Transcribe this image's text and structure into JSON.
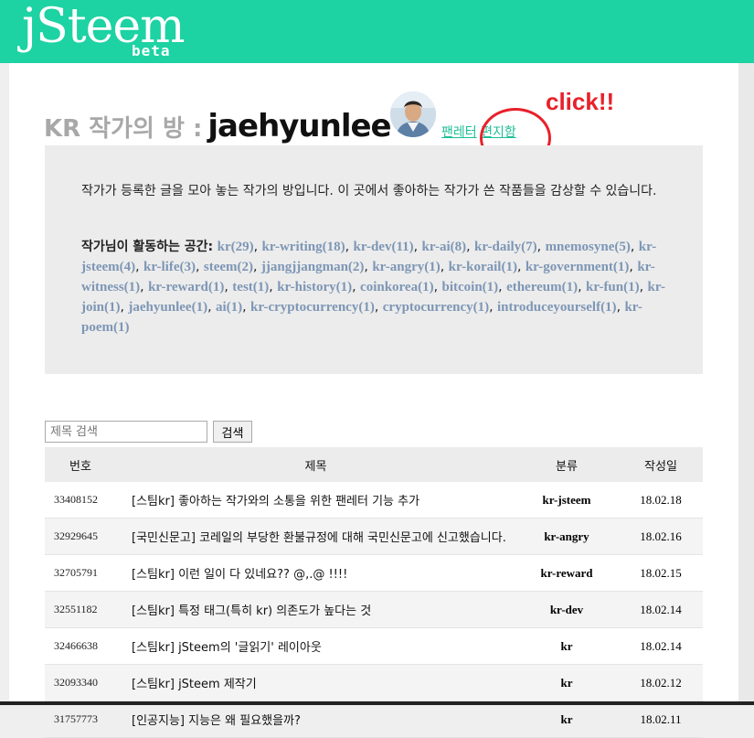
{
  "header": {
    "logo": "jSteem",
    "badge": "beta"
  },
  "page": {
    "title_prefix": "KR 작가의 방 :",
    "author": "jaehyunlee"
  },
  "links": {
    "fan_letter": "팬레터",
    "mailbox": "편지함"
  },
  "annotation": {
    "text": "click!!",
    "color": "#e8202a"
  },
  "intro": {
    "description": "작가가 등록한 글을 모아 놓는 작가의 방입니다. 이 곳에서 좋아하는 작가가 쓴 작품들을 감상할 수 있습니다.",
    "spaces_label": "작가님이 활동하는 공간:",
    "tags": [
      "kr(29)",
      "kr-writing(18)",
      "kr-dev(11)",
      "kr-ai(8)",
      "kr-daily(7)",
      "mnemosyne(5)",
      "kr-jsteem(4)",
      "kr-life(3)",
      "steem(2)",
      "jjangjjangman(2)",
      "kr-angry(1)",
      "kr-korail(1)",
      "kr-government(1)",
      "kr-witness(1)",
      "kr-reward(1)",
      "test(1)",
      "kr-history(1)",
      "coinkorea(1)",
      "bitcoin(1)",
      "ethereum(1)",
      "kr-fun(1)",
      "kr-join(1)",
      "jaehyunlee(1)",
      "ai(1)",
      "kr-cryptocurrency(1)",
      "cryptocurrency(1)",
      "introduceyourself(1)",
      "kr-poem(1)"
    ]
  },
  "search": {
    "placeholder": "제목 검색",
    "button": "검색"
  },
  "table": {
    "headers": {
      "num": "번호",
      "title": "제목",
      "category": "분류",
      "date": "작성일"
    },
    "rows": [
      {
        "num": "33408152",
        "title": "[스팀kr] 좋아하는 작가와의 소통을 위한 팬레터 기능 추가",
        "category": "kr-jsteem",
        "date": "18.02.18"
      },
      {
        "num": "32929645",
        "title": "[국민신문고] 코레일의 부당한 환불규정에 대해 국민신문고에 신고했습니다.",
        "category": "kr-angry",
        "date": "18.02.16"
      },
      {
        "num": "32705791",
        "title": "[스팀kr] 이런 일이 다 있네요?? @,.@ !!!!",
        "category": "kr-reward",
        "date": "18.02.15"
      },
      {
        "num": "32551182",
        "title": "[스팀kr] 특정 태그(특히 kr) 의존도가 높다는 것",
        "category": "kr-dev",
        "date": "18.02.14"
      },
      {
        "num": "32466638",
        "title": "[스팀kr] jSteem의 '글읽기' 레이아웃",
        "category": "kr",
        "date": "18.02.14"
      },
      {
        "num": "32093340",
        "title": "[스팀kr] jSteem 제작기",
        "category": "kr",
        "date": "18.02.12"
      },
      {
        "num": "31757773",
        "title": "[인공지능] 지능은 왜 필요했을까?",
        "category": "kr",
        "date": "18.02.11"
      }
    ]
  },
  "colors": {
    "brand": "#1dd2a3",
    "link": "#1dbf96",
    "tag": "#7d96b5"
  }
}
